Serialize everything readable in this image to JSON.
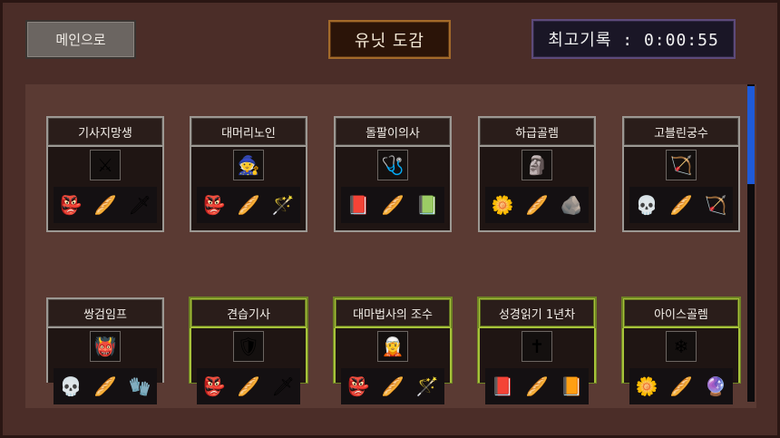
{
  "header": {
    "main_button": "메인으로",
    "title": "유닛 도감",
    "record": "최고기록 : 0:00:55"
  },
  "units": [
    {
      "name": "기사지망생",
      "portrait": "⚔",
      "items": [
        "👺",
        "🥖",
        "🗡"
      ],
      "gold": false
    },
    {
      "name": "대머리노인",
      "portrait": "🧙",
      "items": [
        "👺",
        "🥖",
        "🪄"
      ],
      "gold": false
    },
    {
      "name": "돌팔이의사",
      "portrait": "🩺",
      "items": [
        "📕",
        "🥖",
        "📗"
      ],
      "gold": false
    },
    {
      "name": "하급골렘",
      "portrait": "🗿",
      "items": [
        "🌼",
        "🥖",
        "🪨"
      ],
      "gold": false
    },
    {
      "name": "고블린궁수",
      "portrait": "🏹",
      "items": [
        "💀",
        "🥖",
        "🏹"
      ],
      "gold": false
    },
    {
      "name": "쌍검임프",
      "portrait": "👹",
      "items": [
        "💀",
        "🥖",
        "🧤"
      ],
      "gold": false
    },
    {
      "name": "견습기사",
      "portrait": "🛡",
      "items": [
        "👺",
        "🥖",
        "🗡"
      ],
      "gold": true
    },
    {
      "name": "대마법사의 조수",
      "portrait": "🧝",
      "items": [
        "👺",
        "🥖",
        "🪄"
      ],
      "gold": true
    },
    {
      "name": "성경읽기 1년차",
      "portrait": "✝",
      "items": [
        "📕",
        "🥖",
        "📙"
      ],
      "gold": true
    },
    {
      "name": "아이스골렘",
      "portrait": "❄",
      "items": [
        "🌼",
        "🥖",
        "🔮"
      ],
      "gold": true
    }
  ]
}
